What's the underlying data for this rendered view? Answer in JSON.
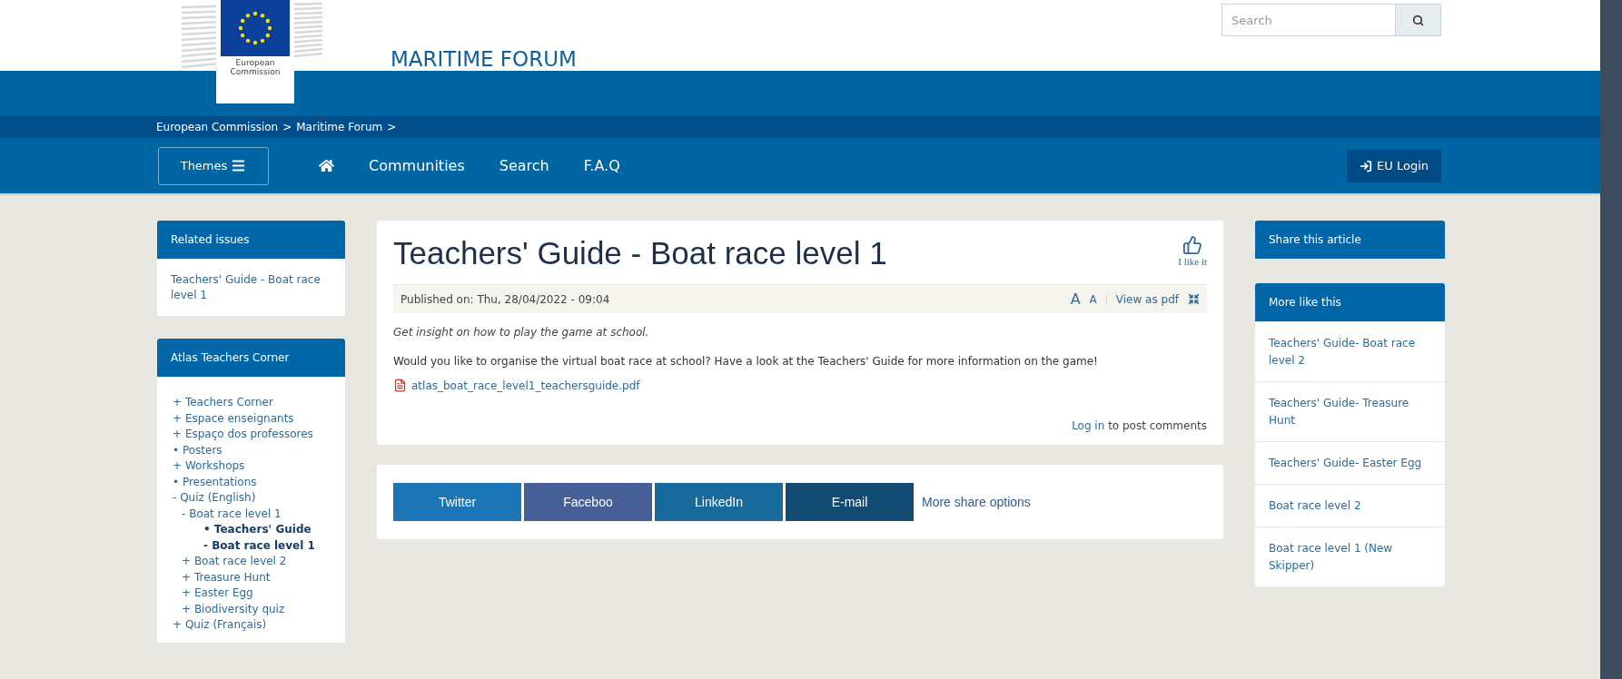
{
  "header": {
    "logo_text": "European Commission",
    "site_title": "MARITIME FORUM",
    "search": {
      "placeholder": "Search"
    }
  },
  "breadcrumb": {
    "items": [
      "European Commission",
      "Maritime Forum"
    ],
    "separator": ">"
  },
  "nav": {
    "themes": "Themes",
    "items": [
      "Communities",
      "Search",
      "F.A.Q"
    ],
    "login": "EU Login"
  },
  "left_sidebar": {
    "related_issues": {
      "title": "Related issues",
      "links": [
        "Teachers' Guide - Boat race level 1"
      ]
    },
    "teachers_corner": {
      "title": "Atlas Teachers Corner",
      "tree": [
        {
          "marker": "+",
          "label": "Teachers Corner",
          "selected": false
        },
        {
          "marker": "+",
          "label": "Espace enseignants",
          "selected": false
        },
        {
          "marker": "+",
          "label": "Espaço dos professores",
          "selected": false
        },
        {
          "marker": "•",
          "label": "Posters",
          "selected": false
        },
        {
          "marker": "+",
          "label": "Workshops",
          "selected": false
        },
        {
          "marker": "•",
          "label": "Presentations",
          "selected": false
        },
        {
          "marker": "-",
          "label": "Quiz (English)",
          "selected": false,
          "children": [
            {
              "marker": "-",
              "label": "Boat race level 1",
              "selected": false,
              "children": [
                {
                  "marker": "•",
                  "label": "Teachers' Guide - Boat race level 1",
                  "selected": true
                }
              ]
            },
            {
              "marker": "+",
              "label": "Boat race level 2",
              "selected": false
            },
            {
              "marker": "+",
              "label": "Treasure Hunt",
              "selected": false
            },
            {
              "marker": "+",
              "label": "Easter Egg",
              "selected": false
            },
            {
              "marker": "+",
              "label": "Biodiversity quiz",
              "selected": false
            }
          ]
        },
        {
          "marker": "+",
          "label": "Quiz (Français)",
          "selected": false
        }
      ]
    }
  },
  "article": {
    "title": "Teachers' Guide - Boat race level 1",
    "like": "I like it",
    "published": "Published on: Thu, 28/04/2022 - 09:04",
    "font_size": [
      "A",
      "A"
    ],
    "view_pdf": "View as pdf",
    "summary": "Get insight on how to play the game at school.",
    "body": "Would you like to organise the virtual boat race at school? Have a look at the Teachers' Guide for more information on the game!",
    "attachment": "atlas_boat_race_level1_teachersguide.pdf",
    "comments": {
      "link": "Log in",
      "text": "to post comments"
    }
  },
  "share": {
    "buttons": [
      {
        "label": "Twitter",
        "color": "#1b75b6"
      },
      {
        "label": "Faceboo",
        "color": "#465f97"
      },
      {
        "label": "LinkedIn",
        "color": "#196a9c"
      },
      {
        "label": "E-mail",
        "color": "#134b73"
      }
    ],
    "more": "More share options"
  },
  "right_sidebar": {
    "share_title": "Share this article",
    "more_like_this": {
      "title": "More like this",
      "items": [
        "Teachers' Guide- Boat race level 2",
        "Teachers' Guide- Treasure Hunt",
        "Teachers' Guide- Easter Egg",
        "Boat race level 2",
        "Boat race level 1 (New Skipper)"
      ]
    }
  }
}
